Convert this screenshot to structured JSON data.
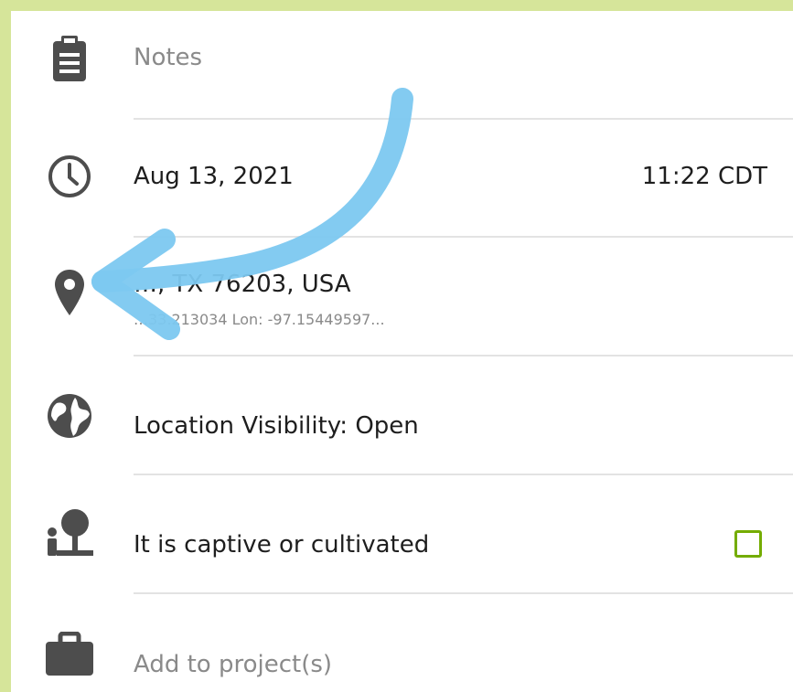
{
  "colors": {
    "frame": "#d6e59a",
    "icon": "#4d4d4d",
    "checkbox_border": "#74ac00",
    "annotation_arrow": "#7cc8f0"
  },
  "rows": {
    "notes": {
      "label": "Notes",
      "icon": "clipboard-icon"
    },
    "datetime": {
      "date": "Aug 13, 2021",
      "time": "11:22 CDT",
      "icon": "clock-icon"
    },
    "location": {
      "place": "…, TX 76203, USA",
      "coords": "…33.213034 Lon: -97.15449597...",
      "icon": "map-pin-icon"
    },
    "visibility": {
      "label": "Location Visibility: Open",
      "icon": "globe-icon"
    },
    "captive": {
      "label": "It is captive or cultivated",
      "checked": false,
      "icon": "captive-tree-icon"
    },
    "project": {
      "label": "Add to project(s)",
      "icon": "briefcase-icon"
    }
  }
}
